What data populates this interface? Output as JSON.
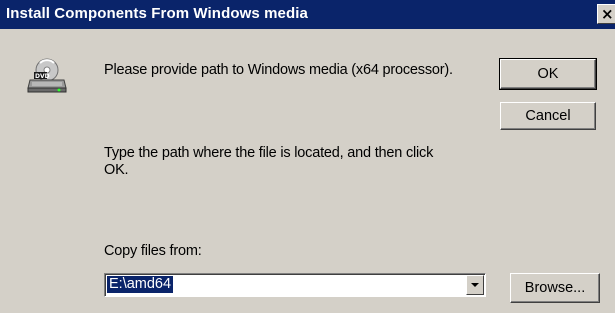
{
  "window": {
    "title": "Install Components From Windows media",
    "close_glyph": "×"
  },
  "icons": {
    "media": "dvd-drive-icon",
    "close": "close-icon",
    "dropdown": "chevron-down-icon"
  },
  "dialog": {
    "prompt": "Please provide path to Windows media (x64 processor).",
    "instruction_line1": "Type the path where the file is located, and then click",
    "instruction_line2": "OK.",
    "copy_files_label": "Copy files from:",
    "path_value": "E:\\amd64"
  },
  "buttons": {
    "ok": "OK",
    "cancel": "Cancel",
    "browse": "Browse..."
  },
  "colors": {
    "title_bar": "#0a246a",
    "face": "#d4d0c8",
    "selection": "#0a246a"
  }
}
